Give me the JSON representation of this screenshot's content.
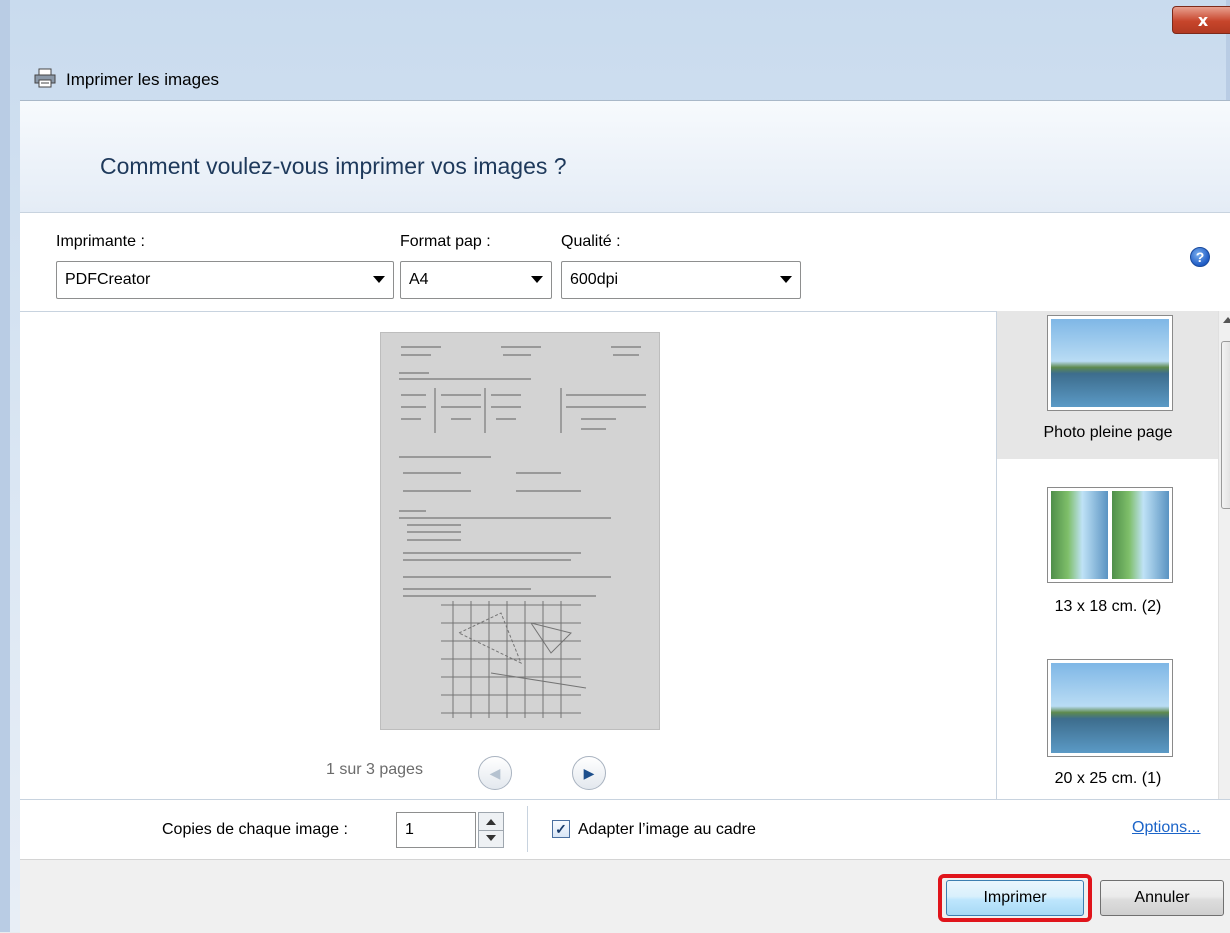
{
  "window": {
    "title": "Imprimer les images",
    "close_label": "x"
  },
  "header": {
    "question": "Comment voulez-vous imprimer vos images ?"
  },
  "printer": {
    "label": "Imprimante :",
    "value": "PDFCreator"
  },
  "paper": {
    "label": "Format pap :",
    "value": "A4"
  },
  "quality": {
    "label": "Qualité :",
    "value": "600dpi"
  },
  "help_label": "?",
  "preview": {
    "pager_text": "1 sur 3 pages"
  },
  "layouts": [
    {
      "label": "Photo pleine page",
      "selected": true
    },
    {
      "label": "13 x 18 cm. (2)",
      "selected": false
    },
    {
      "label": "20 x 25 cm. (1)",
      "selected": false
    }
  ],
  "copies": {
    "label": "Copies de chaque image :",
    "value": "1"
  },
  "fit": {
    "label": "Adapter l’image au cadre",
    "checked": true
  },
  "options_link": "Options...",
  "buttons": {
    "print": "Imprimer",
    "cancel": "Annuler"
  },
  "colors": {
    "highlight": "#e0141b",
    "link": "#1b64c8",
    "heading": "#1e395b"
  }
}
